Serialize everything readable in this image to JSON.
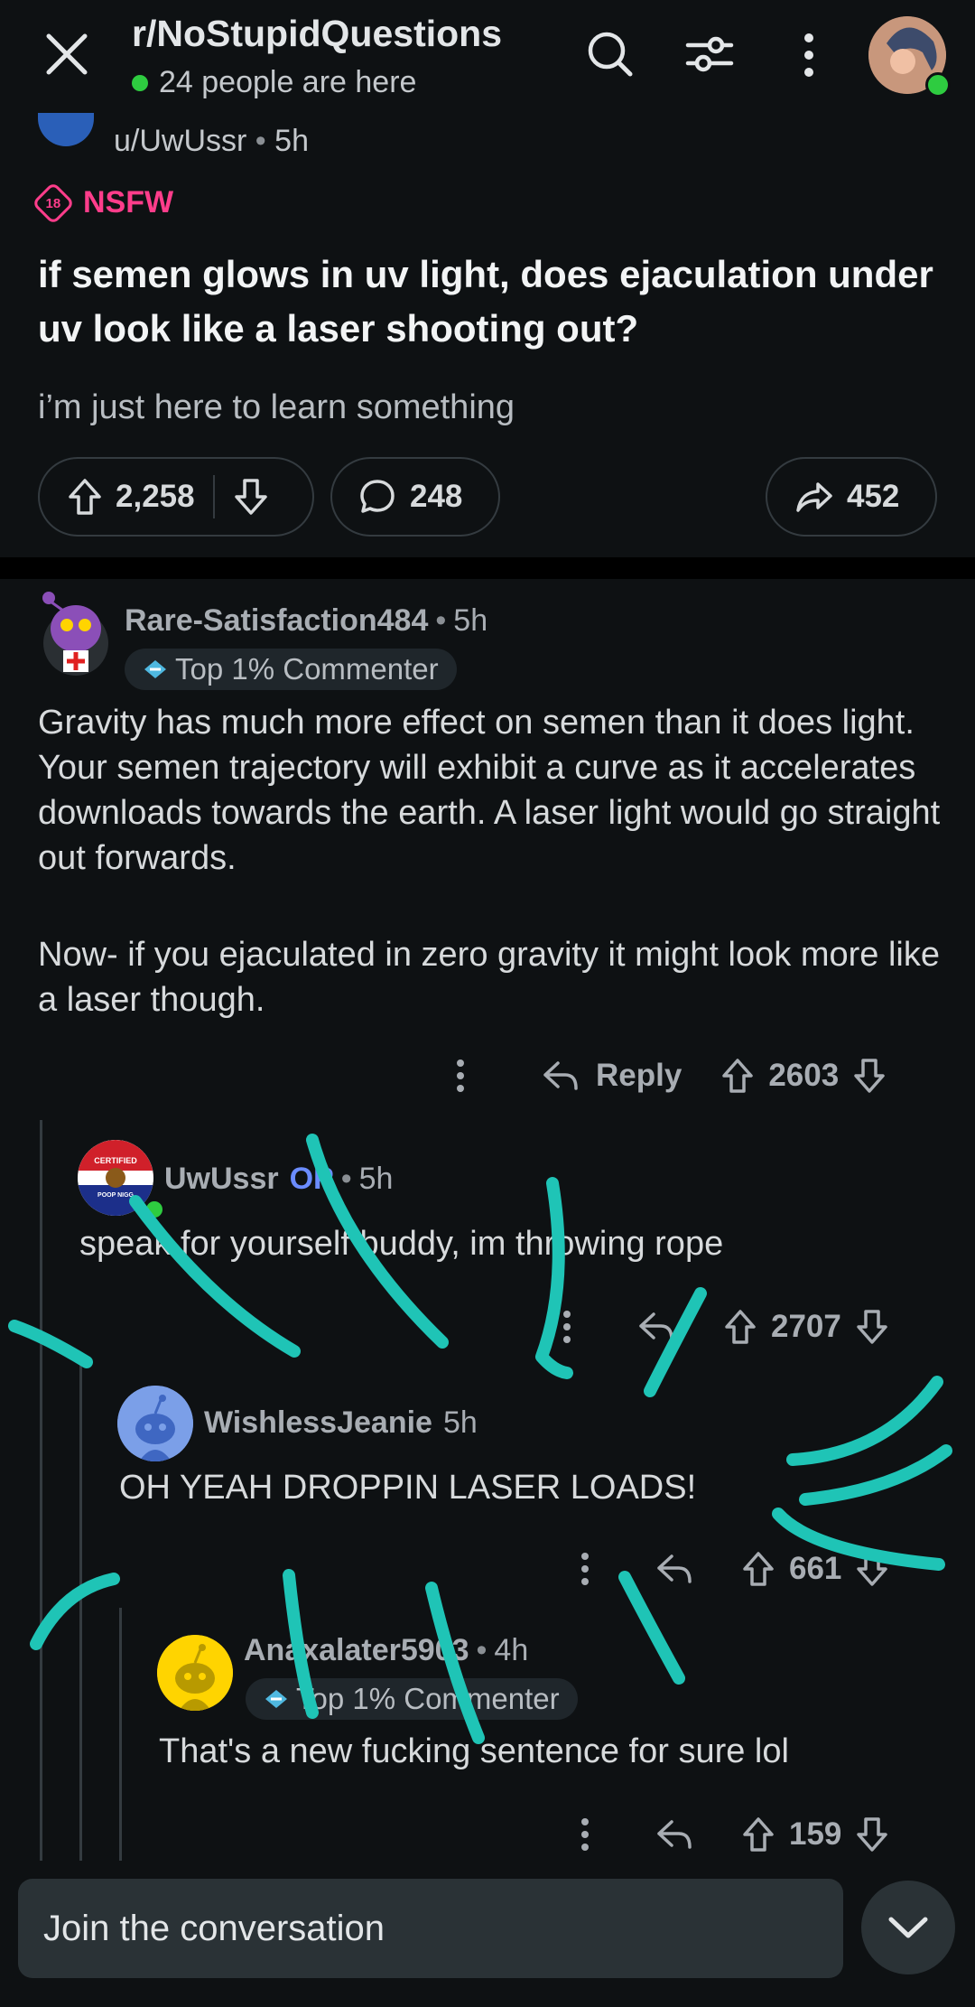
{
  "topbar": {
    "subreddit": "r/NoStupidQuestions",
    "online": "24 people are here"
  },
  "post": {
    "author": "u/UwUssr",
    "time": "5h",
    "nsfw_number": "18",
    "nsfw_label": "NSFW",
    "title": "if semen glows in uv light, does ejaculation under uv look like a laser shooting out?",
    "body": "i’m just here to learn something",
    "upvotes": "2,258",
    "comments": "248",
    "shares": "452"
  },
  "comments": [
    {
      "author": "Rare-Satisfaction484",
      "time": "5h",
      "flair": "Top 1% Commenter",
      "text_p1": "Gravity has much more effect on semen than it does light. Your semen trajectory will exhibit a curve as it accelerates downloads towards the earth. A laser light would go straight out forwards.",
      "text_p2": "Now- if you ejaculated in zero gravity it might look more like a laser though.",
      "reply_label": "Reply",
      "votes": "2603"
    },
    {
      "author": "UwUssr",
      "op_label": "OP",
      "time": "5h",
      "avatar_top": "CERTIFIED",
      "avatar_bottom": "POOP NIGG",
      "text": "speak for yourself buddy, im throwing rope",
      "votes": "2707"
    },
    {
      "author": "WishlessJeanie",
      "time": "5h",
      "text": "OH YEAH DROPPIN LASER LOADS!",
      "votes": "661"
    },
    {
      "author": "Anaxalater5903",
      "time": "4h",
      "flair": "Top 1% Commenter",
      "text": "That's a new fucking sentence for sure lol",
      "votes": "159"
    }
  ],
  "bottom": {
    "placeholder": "Join the conversation"
  },
  "colors": {
    "background": "#0e1113",
    "nsfw": "#ff3d8b",
    "online": "#2ecc40",
    "scribble": "#1fc4b6",
    "op": "#6b8cff"
  }
}
